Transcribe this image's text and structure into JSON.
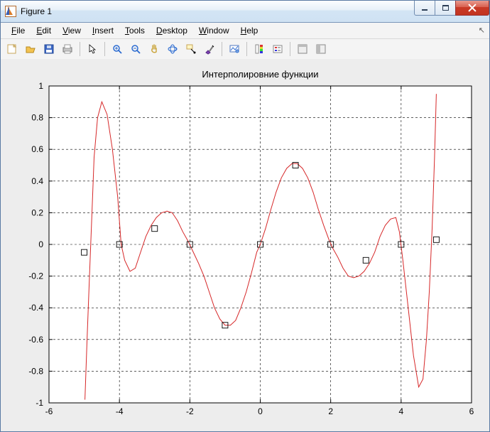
{
  "window": {
    "title": "Figure 1"
  },
  "menubar": {
    "items": [
      {
        "label": "File",
        "accel": "F"
      },
      {
        "label": "Edit",
        "accel": "E"
      },
      {
        "label": "View",
        "accel": "V"
      },
      {
        "label": "Insert",
        "accel": "I"
      },
      {
        "label": "Tools",
        "accel": "T"
      },
      {
        "label": "Desktop",
        "accel": "D"
      },
      {
        "label": "Window",
        "accel": "W"
      },
      {
        "label": "Help",
        "accel": "H"
      }
    ]
  },
  "toolbar": {
    "icons": [
      "new-figure-icon",
      "open-icon",
      "save-icon",
      "print-icon",
      "sep",
      "pointer-icon",
      "sep",
      "zoom-in-icon",
      "zoom-out-icon",
      "pan-icon",
      "rotate3d-icon",
      "data-cursor-icon",
      "brush-icon",
      "sep",
      "link-plot-icon",
      "sep",
      "colorbar-icon",
      "legend-icon",
      "sep",
      "hide-tools-icon",
      "dock-icon"
    ]
  },
  "chart_data": {
    "type": "line",
    "title": "Интерполировние функции",
    "xlabel": "",
    "ylabel": "",
    "xlim": [
      -6,
      6
    ],
    "ylim": [
      -1,
      1
    ],
    "xticks": [
      -6,
      -4,
      -2,
      0,
      2,
      4,
      6
    ],
    "yticks": [
      -1,
      -0.8,
      -0.6,
      -0.4,
      -0.2,
      0,
      0.2,
      0.4,
      0.6,
      0.8,
      1
    ],
    "grid": true,
    "series": [
      {
        "name": "interpolant",
        "style": "line",
        "curve": [
          [
            -4.98,
            -0.98
          ],
          [
            -4.92,
            -0.6
          ],
          [
            -4.85,
            -0.2
          ],
          [
            -4.78,
            0.2
          ],
          [
            -4.72,
            0.55
          ],
          [
            -4.62,
            0.8
          ],
          [
            -4.5,
            0.9
          ],
          [
            -4.35,
            0.82
          ],
          [
            -4.2,
            0.6
          ],
          [
            -4.05,
            0.3
          ],
          [
            -3.95,
            0.0
          ],
          [
            -3.85,
            -0.1
          ],
          [
            -3.7,
            -0.17
          ],
          [
            -3.55,
            -0.15
          ],
          [
            -3.4,
            -0.05
          ],
          [
            -3.25,
            0.05
          ],
          [
            -3.1,
            0.12
          ],
          [
            -2.95,
            0.17
          ],
          [
            -2.8,
            0.2
          ],
          [
            -2.65,
            0.21
          ],
          [
            -2.5,
            0.2
          ],
          [
            -2.35,
            0.15
          ],
          [
            -2.2,
            0.08
          ],
          [
            -2.05,
            0.02
          ],
          [
            -1.9,
            -0.05
          ],
          [
            -1.75,
            -0.12
          ],
          [
            -1.6,
            -0.2
          ],
          [
            -1.45,
            -0.3
          ],
          [
            -1.3,
            -0.4
          ],
          [
            -1.15,
            -0.47
          ],
          [
            -1.0,
            -0.51
          ],
          [
            -0.85,
            -0.51
          ],
          [
            -0.7,
            -0.48
          ],
          [
            -0.55,
            -0.4
          ],
          [
            -0.4,
            -0.3
          ],
          [
            -0.25,
            -0.18
          ],
          [
            -0.1,
            -0.05
          ],
          [
            0.0,
            0.0
          ],
          [
            0.15,
            0.1
          ],
          [
            0.3,
            0.22
          ],
          [
            0.45,
            0.33
          ],
          [
            0.6,
            0.42
          ],
          [
            0.75,
            0.48
          ],
          [
            0.9,
            0.51
          ],
          [
            1.05,
            0.51
          ],
          [
            1.2,
            0.48
          ],
          [
            1.35,
            0.42
          ],
          [
            1.5,
            0.33
          ],
          [
            1.65,
            0.22
          ],
          [
            1.8,
            0.12
          ],
          [
            1.95,
            0.03
          ],
          [
            2.05,
            -0.02
          ],
          [
            2.2,
            -0.08
          ],
          [
            2.35,
            -0.15
          ],
          [
            2.5,
            -0.2
          ],
          [
            2.65,
            -0.21
          ],
          [
            2.8,
            -0.2
          ],
          [
            2.95,
            -0.17
          ],
          [
            3.1,
            -0.12
          ],
          [
            3.25,
            -0.05
          ],
          [
            3.4,
            0.05
          ],
          [
            3.55,
            0.12
          ],
          [
            3.7,
            0.16
          ],
          [
            3.85,
            0.17
          ],
          [
            3.95,
            0.08
          ],
          [
            4.05,
            -0.1
          ],
          [
            4.2,
            -0.4
          ],
          [
            4.35,
            -0.7
          ],
          [
            4.5,
            -0.9
          ],
          [
            4.62,
            -0.85
          ],
          [
            4.72,
            -0.6
          ],
          [
            4.8,
            -0.3
          ],
          [
            4.88,
            0.1
          ],
          [
            4.95,
            0.55
          ],
          [
            5.0,
            0.95
          ]
        ]
      },
      {
        "name": "nodes",
        "style": "markers",
        "points": [
          [
            -5,
            -0.05
          ],
          [
            -4,
            0.0
          ],
          [
            -3,
            0.1
          ],
          [
            -2,
            0.0
          ],
          [
            -1,
            -0.51
          ],
          [
            0,
            0.0
          ],
          [
            1,
            0.5
          ],
          [
            2,
            0.0
          ],
          [
            3,
            -0.1
          ],
          [
            4,
            0.0
          ],
          [
            5,
            0.03
          ]
        ]
      }
    ]
  }
}
